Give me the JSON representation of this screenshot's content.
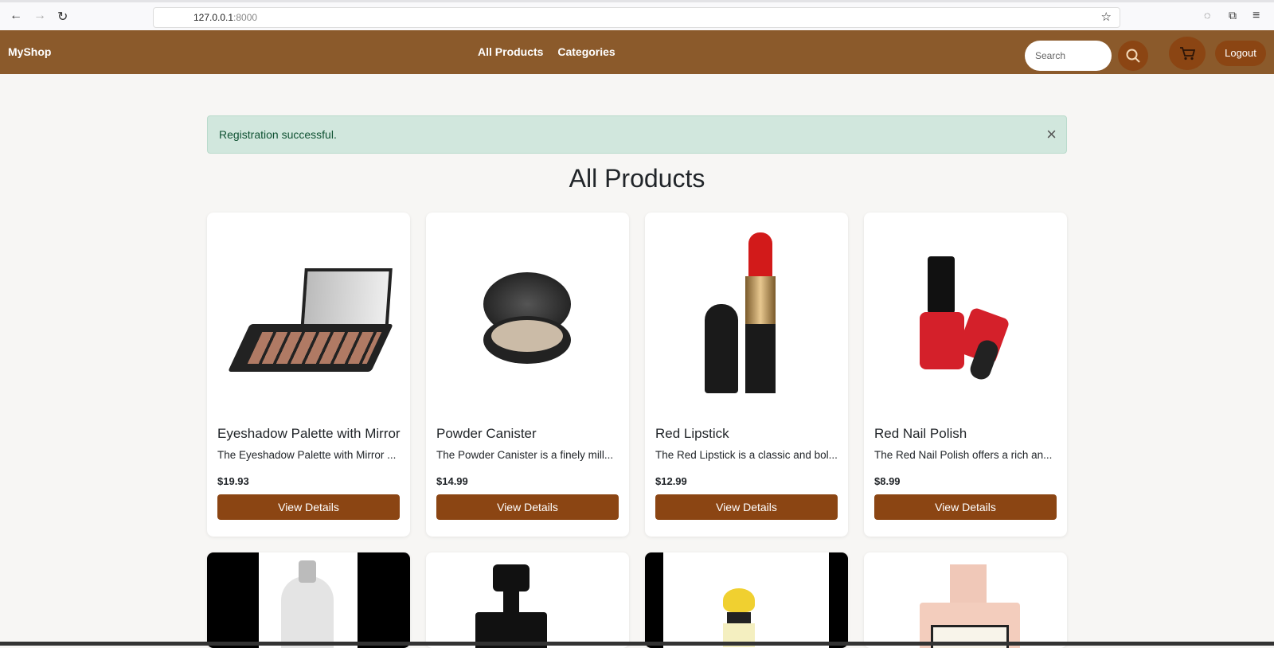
{
  "browser": {
    "url_host": "127.0.0.1",
    "url_port": ":8000"
  },
  "nav": {
    "brand": "MyShop",
    "links": [
      "All Products",
      "Categories"
    ],
    "search_placeholder": "Search",
    "logout": "Logout"
  },
  "alert": {
    "message": "Registration successful.",
    "close": "×"
  },
  "page_title": "All Products",
  "products": [
    {
      "name": "Eyeshadow Palette with Mirror",
      "desc": "The Eyeshadow Palette with Mirror ...",
      "price": "$19.93",
      "button": "View Details"
    },
    {
      "name": "Powder Canister",
      "desc": "The Powder Canister is a finely mill...",
      "price": "$14.99",
      "button": "View Details"
    },
    {
      "name": "Red Lipstick",
      "desc": "The Red Lipstick is a classic and bol...",
      "price": "$12.99",
      "button": "View Details"
    },
    {
      "name": "Red Nail Polish",
      "desc": "The Red Nail Polish offers a rich an...",
      "price": "$8.99",
      "button": "View Details"
    }
  ],
  "colors": {
    "nav": "#8b5a2b",
    "button": "#8b4513",
    "alert": "#d1e7dd"
  }
}
